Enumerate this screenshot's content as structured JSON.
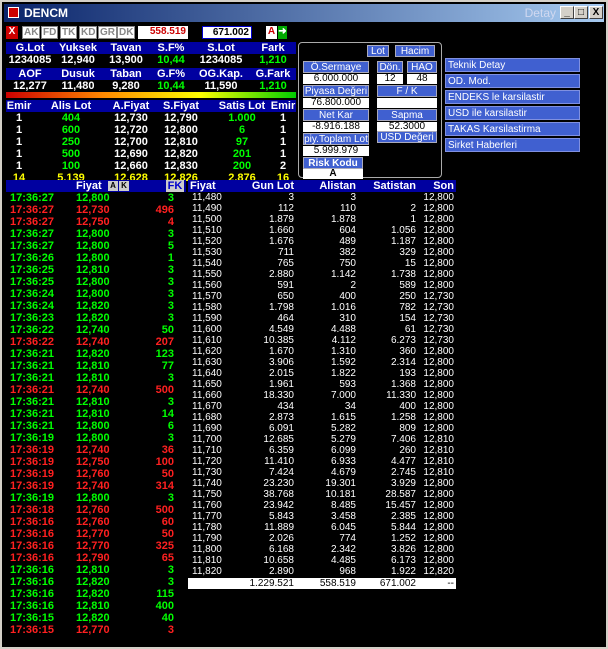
{
  "window": {
    "title": "DENCM",
    "detail": "Detay",
    "min": "_",
    "max": "□",
    "close": "X"
  },
  "toolbar": {
    "x": "X",
    "tabs": [
      "AK",
      "FD",
      "TK",
      "KD",
      "GR",
      "DK"
    ],
    "lot": "558.519",
    "hacim": "671.002",
    "a": "A",
    "arrow": "➜"
  },
  "summary1": {
    "headers": [
      "G.Lot",
      "Yuksek",
      "Tavan",
      "S.F%",
      "S.Lot",
      "Fark"
    ],
    "values": [
      "1234085",
      "12,940",
      "13,900",
      "10,44",
      "1234085",
      "1,210"
    ]
  },
  "summary2": {
    "headers": [
      "AOF",
      "Dusuk",
      "Taban",
      "G.F%",
      "OG.Kap.",
      "G.Fark"
    ],
    "values": [
      "12,277",
      "11,480",
      "9,280",
      "10,44",
      "11,590",
      "1,210"
    ]
  },
  "orders": {
    "headers": [
      "Emir",
      "Alis Lot",
      "A.Fiyat",
      "S.Fiyat",
      "Satis Lot",
      "Emir"
    ],
    "rows": [
      [
        "1",
        "404",
        "12,730",
        "12,790",
        "1.000",
        "1"
      ],
      [
        "1",
        "600",
        "12,720",
        "12,800",
        "6",
        "1"
      ],
      [
        "1",
        "250",
        "12,700",
        "12,810",
        "97",
        "1"
      ],
      [
        "1",
        "500",
        "12,690",
        "12,820",
        "201",
        "1"
      ],
      [
        "1",
        "100",
        "12,660",
        "12,830",
        "200",
        "2"
      ],
      [
        "14",
        "5.139",
        "12,628",
        "12,826",
        "2.876",
        "16"
      ]
    ]
  },
  "panel": {
    "lot": "Lot",
    "hacim": "Hacim",
    "osermaye_l": "Ö.Sermaye",
    "osermaye": "6.000.000",
    "don_l": "Dön.",
    "don": "12",
    "hao_l": "HAO",
    "hao": "48",
    "piyasa_l": "Piyasa Değeri",
    "piyasa": "76.800.000",
    "fk_l": "F / K",
    "fk": "",
    "netkar_l": "Net Kar",
    "netkar": "-8.916.188",
    "sapma_l": "Sapma",
    "sapma": "52.3000",
    "ptoplam_l": "piy.Toplam Lot",
    "ptoplam": "5.999.979",
    "usd_l": "USD Değeri",
    "risk_l": "Risk Kodu",
    "risk": "A"
  },
  "menu": [
    "Teknik Detay",
    "OD. Mod.",
    "ENDEKS le karsilastir",
    "USD ile karsilastir",
    "TAKAS Karsilastirma",
    "Sirket Haberleri"
  ],
  "trades_header": {
    "fiyat": "Fiyat",
    "a": "A",
    "k": "K",
    "fk": "FK"
  },
  "trades": [
    [
      "17:36:27",
      "12,800",
      "3",
      "g"
    ],
    [
      "17:36:27",
      "12,730",
      "496",
      "r"
    ],
    [
      "17:36:27",
      "12,750",
      "4",
      "r"
    ],
    [
      "17:36:27",
      "12,800",
      "3",
      "g"
    ],
    [
      "17:36:27",
      "12,800",
      "5",
      "g"
    ],
    [
      "17:36:26",
      "12,800",
      "1",
      "g"
    ],
    [
      "17:36:25",
      "12,810",
      "3",
      "g"
    ],
    [
      "17:36:25",
      "12,800",
      "3",
      "g"
    ],
    [
      "17:36:24",
      "12,800",
      "3",
      "g"
    ],
    [
      "17:36:24",
      "12,820",
      "3",
      "g"
    ],
    [
      "17:36:23",
      "12,820",
      "3",
      "g"
    ],
    [
      "17:36:22",
      "12,740",
      "50",
      "g"
    ],
    [
      "17:36:22",
      "12,740",
      "207",
      "r"
    ],
    [
      "17:36:21",
      "12,820",
      "123",
      "g"
    ],
    [
      "17:36:21",
      "12,810",
      "77",
      "g"
    ],
    [
      "17:36:21",
      "12,810",
      "3",
      "g"
    ],
    [
      "17:36:21",
      "12,740",
      "500",
      "r"
    ],
    [
      "17:36:21",
      "12,810",
      "3",
      "g"
    ],
    [
      "17:36:21",
      "12,810",
      "14",
      "g"
    ],
    [
      "17:36:21",
      "12,800",
      "6",
      "g"
    ],
    [
      "17:36:19",
      "12,800",
      "3",
      "g"
    ],
    [
      "17:36:19",
      "12,740",
      "36",
      "r"
    ],
    [
      "17:36:19",
      "12,750",
      "100",
      "r"
    ],
    [
      "17:36:19",
      "12,760",
      "50",
      "r"
    ],
    [
      "17:36:19",
      "12,740",
      "314",
      "r"
    ],
    [
      "17:36:19",
      "12,800",
      "3",
      "g"
    ],
    [
      "17:36:18",
      "12,760",
      "500",
      "r"
    ],
    [
      "17:36:16",
      "12,760",
      "60",
      "r"
    ],
    [
      "17:36:16",
      "12,770",
      "50",
      "r"
    ],
    [
      "17:36:16",
      "12,770",
      "325",
      "r"
    ],
    [
      "17:36:16",
      "12,790",
      "65",
      "r"
    ],
    [
      "17:36:16",
      "12,810",
      "3",
      "g"
    ],
    [
      "17:36:16",
      "12,820",
      "3",
      "g"
    ],
    [
      "17:36:16",
      "12,820",
      "115",
      "g"
    ],
    [
      "17:36:16",
      "12,810",
      "400",
      "g"
    ],
    [
      "17:36:15",
      "12,820",
      "40",
      "g"
    ],
    [
      "17:36:15",
      "12,770",
      "3",
      "r"
    ]
  ],
  "depth_header": {
    "fiyat": "Fiyat",
    "gun": "Gun Lot",
    "alis": "Alistan",
    "satis": "Satistan",
    "son": "Son"
  },
  "depth": [
    [
      "11,480",
      "3",
      "3",
      "",
      "12,800"
    ],
    [
      "11,490",
      "112",
      "110",
      "2",
      "12,800"
    ],
    [
      "11,500",
      "1.879",
      "1.878",
      "1",
      "12,800"
    ],
    [
      "11,510",
      "1.660",
      "604",
      "1.056",
      "12,800"
    ],
    [
      "11,520",
      "1.676",
      "489",
      "1.187",
      "12,800"
    ],
    [
      "11,530",
      "711",
      "382",
      "329",
      "12,800"
    ],
    [
      "11,540",
      "765",
      "750",
      "15",
      "12,800"
    ],
    [
      "11,550",
      "2.880",
      "1.142",
      "1.738",
      "12,800"
    ],
    [
      "11,560",
      "591",
      "2",
      "589",
      "12,800"
    ],
    [
      "11,570",
      "650",
      "400",
      "250",
      "12,730"
    ],
    [
      "11,580",
      "1.798",
      "1.016",
      "782",
      "12,730"
    ],
    [
      "11,590",
      "464",
      "310",
      "154",
      "12,730"
    ],
    [
      "11,600",
      "4.549",
      "4.488",
      "61",
      "12,730"
    ],
    [
      "11,610",
      "10.385",
      "4.112",
      "6.273",
      "12,730"
    ],
    [
      "11,620",
      "1.670",
      "1.310",
      "360",
      "12,800"
    ],
    [
      "11,630",
      "3.906",
      "1.592",
      "2.314",
      "12,800"
    ],
    [
      "11,640",
      "2.015",
      "1.822",
      "193",
      "12,800"
    ],
    [
      "11,650",
      "1.961",
      "593",
      "1.368",
      "12,800"
    ],
    [
      "11,660",
      "18.330",
      "7.000",
      "11.330",
      "12,800"
    ],
    [
      "11,670",
      "434",
      "34",
      "400",
      "12,800"
    ],
    [
      "11,680",
      "2.873",
      "1.615",
      "1.258",
      "12,800"
    ],
    [
      "11,690",
      "6.091",
      "5.282",
      "809",
      "12,800"
    ],
    [
      "11,700",
      "12.685",
      "5.279",
      "7.406",
      "12,810"
    ],
    [
      "11,710",
      "6.359",
      "6.099",
      "260",
      "12,810"
    ],
    [
      "11,720",
      "11.410",
      "6.933",
      "4.477",
      "12,810"
    ],
    [
      "11,730",
      "7.424",
      "4.679",
      "2.745",
      "12,810"
    ],
    [
      "11,740",
      "23.230",
      "19.301",
      "3.929",
      "12,800"
    ],
    [
      "11,750",
      "38.768",
      "10.181",
      "28.587",
      "12,800"
    ],
    [
      "11,760",
      "23.942",
      "8.485",
      "15.457",
      "12,800"
    ],
    [
      "11,770",
      "5.843",
      "3.458",
      "2.385",
      "12,800"
    ],
    [
      "11,780",
      "11.889",
      "6.045",
      "5.844",
      "12,800"
    ],
    [
      "11,790",
      "2.026",
      "774",
      "1.252",
      "12,800"
    ],
    [
      "11,800",
      "6.168",
      "2.342",
      "3.826",
      "12,800"
    ],
    [
      "11,810",
      "10.658",
      "4.485",
      "6.173",
      "12,800"
    ],
    [
      "11,820",
      "2.890",
      "968",
      "1.922",
      "12,820"
    ]
  ],
  "depth_total": {
    "gun": "1.229.521",
    "alis": "558.519",
    "satis": "671.002",
    "son": "--"
  },
  "colors": {
    "green": "#00ff00",
    "red": "#ff2020",
    "yellow": "#ffff00",
    "header": "#0000a0"
  }
}
